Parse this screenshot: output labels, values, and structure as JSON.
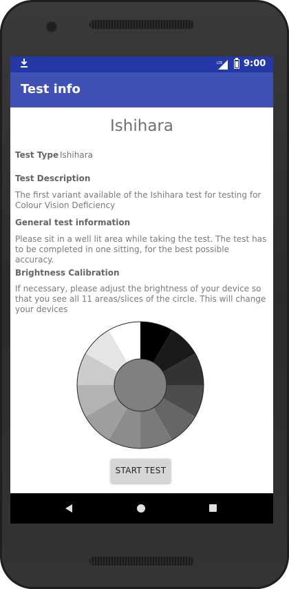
{
  "statusbar": {
    "download_icon": "download-icon",
    "signal_icon": "lte-signal-icon",
    "signal_badge": "LTE",
    "battery_icon": "battery-charging-icon",
    "time": "9:00",
    "color": "#2438a8"
  },
  "appbar": {
    "title": "Test info",
    "color": "#3f51b5"
  },
  "content": {
    "title": "Ishihara",
    "test_type_label": "Test Type",
    "test_type_value": "Ishihara",
    "description_heading": "Test Description",
    "description_text": "The first variant available of the Ishihara test for testing for Colour Vision Deficiency",
    "general_heading": "General test information",
    "general_text": "Please sit in a well lit area while taking the test. The test has to be completed in one sitting, for the best possible accuracy.",
    "brightness_heading": "Brightness Calibration",
    "brightness_text": "If necessary, please adjust the brightness of your device so that you see all 11 areas/slices of the circle. This will change your devices",
    "brightness_wheel": {
      "slice_count": 11,
      "slice_colors": [
        "#000000",
        "#1a1a1a",
        "#333333",
        "#4d4d4d",
        "#666666",
        "#7a7a7a",
        "#8c8c8c",
        "#9e9e9e",
        "#b3b3b3",
        "#cccccc",
        "#e5e5e5",
        "#ffffff"
      ],
      "center_color": "#808080"
    },
    "start_button_label": "START TEST"
  },
  "navbar": {
    "back_icon": "back-icon",
    "home_icon": "home-icon",
    "recent_icon": "recent-apps-icon"
  }
}
